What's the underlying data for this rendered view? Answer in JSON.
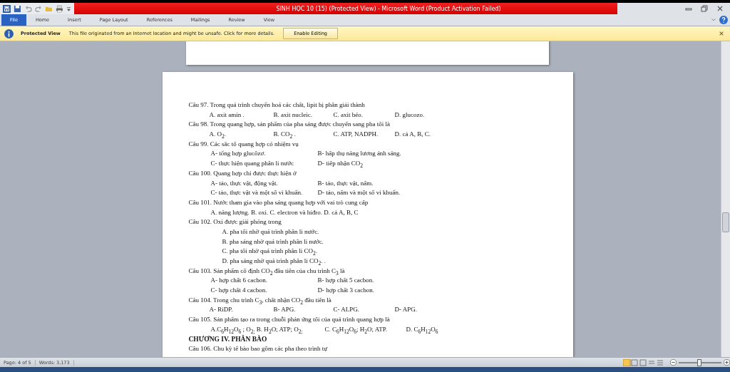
{
  "window": {
    "title": "SINH HỌC 10 (15) (Protected View) - Microsoft Word (Product Activation Failed)"
  },
  "ribbon_tabs": [
    {
      "label": "File",
      "selected": true
    },
    {
      "label": "Home",
      "selected": false
    },
    {
      "label": "Insert",
      "selected": false
    },
    {
      "label": "Page Layout",
      "selected": false
    },
    {
      "label": "References",
      "selected": false
    },
    {
      "label": "Mailings",
      "selected": false
    },
    {
      "label": "Review",
      "selected": false
    },
    {
      "label": "View",
      "selected": false
    }
  ],
  "message_bar": {
    "title": "Protected View",
    "text": "This file originated from an Internet location and might be unsafe. Click for more details.",
    "button": "Enable Editing"
  },
  "document": [
    {
      "kind": "question",
      "text": "Câu 97. Trong quá trình chuyển hoá các chất, lipit bị phân giải thành"
    },
    {
      "kind": "row4",
      "options": [
        "A. axit amin .",
        "B. axit nucleic.",
        "C. axit béo.",
        "D. glucozo."
      ]
    },
    {
      "kind": "question",
      "text": "Câu 98. Trong quang hợp, sản phẩm của pha sáng được chuyển sang pha tối là"
    },
    {
      "kind": "row4",
      "options": [
        "A. O$_{2}$.",
        "B. CO$_{2}$ .",
        "C. ATP, NADPH.",
        "D. cả A, B, C."
      ]
    },
    {
      "kind": "question",
      "text": "Câu 99. Các sắc tố quang hợp có nhiệm vụ"
    },
    {
      "kind": "row2",
      "options": [
        "A- tổng hợp glucôzơ.",
        "B- hấp thụ năng lương ánh sáng."
      ]
    },
    {
      "kind": "row2",
      "options": [
        "C- thực hiện quang phân li nước",
        "D- tiếp nhận CO$_{2}$"
      ]
    },
    {
      "kind": "question",
      "text": "Câu 100. Quang hợp chỉ được thực hiện ở"
    },
    {
      "kind": "row2",
      "options": [
        "A- tảo, thực vật, động vật.",
        "B- tảo, thực vật, nấm."
      ]
    },
    {
      "kind": "row2",
      "options": [
        "C- tảo, thực vật và một số vi khuẩn.",
        "D- tảo, nấm và một số vi khuẩn."
      ]
    },
    {
      "kind": "question",
      "text": "Câu 101. Nước tham gia vào pha sáng quang hợp với vai trò cung cấp"
    },
    {
      "kind": "inline",
      "options": [
        "A. năng lượng. B. oxi.  C. electron và hiđro.   D. cả A, B, C"
      ]
    },
    {
      "kind": "question",
      "text": "Câu 102. Oxi được giải phóng trong"
    },
    {
      "kind": "list",
      "options": [
        "A.  pha tối nhờ quá trình phân li nước.",
        "B.  pha sáng nhờ quá trình phân li nước.",
        "C.  pha tối nhờ quá trình phân li CO$_{2}$.",
        "D.  pha sáng nhờ quá trình phân li CO$_{2}$. ."
      ]
    },
    {
      "kind": "question",
      "text": "Câu 103. Sản phẩm cố  định CO$_{2}$ đầu tiên của chu trình C$_{3}$ là"
    },
    {
      "kind": "row2",
      "options": [
        "A- hợp chất 6 cacbon.",
        "B- hợp chất 5 cacbon."
      ]
    },
    {
      "kind": "row2",
      "options": [
        "C- hợp chất 4 cacbon.",
        "D- hợp chất 3 cacbon."
      ]
    },
    {
      "kind": "question",
      "text": "Câu 104. Trong chu trình C$_{3}$, chất nhận CO$_{2}$ đầu tiên là"
    },
    {
      "kind": "row4",
      "options": [
        "A- RiDP.",
        "B- APG.",
        "C- ALPG.",
        "D- APG."
      ]
    },
    {
      "kind": "question",
      "text": "Câu 105. Sản phẩm tạo ra trong chuỗi phản ứng tối của quá trình quang hợp là"
    },
    {
      "kind": "row3",
      "options": [
        "A.C$_{6}$H$_{12}$O$_{6}$ ; O$_{2;}$ B. H$_{2}$O; ATP; O$_{2;}$",
        "C. C$_{6}$H$_{12}$O$_{6}$; H$_{2}$O; ATP.",
        "D. C$_{6}$H$_{12}$O$_{6}$"
      ]
    },
    {
      "kind": "heading",
      "text": "CHƯƠNG IV. PHÂN BÀO"
    },
    {
      "kind": "question",
      "text": "Câu 106. Chu kỳ tế bào bao gồm các pha theo trình tự"
    }
  ],
  "status_bar": {
    "page": "Page: 4 of 5",
    "words": "Words: 3,173",
    "zoom": {
      "level": 0.48
    }
  }
}
